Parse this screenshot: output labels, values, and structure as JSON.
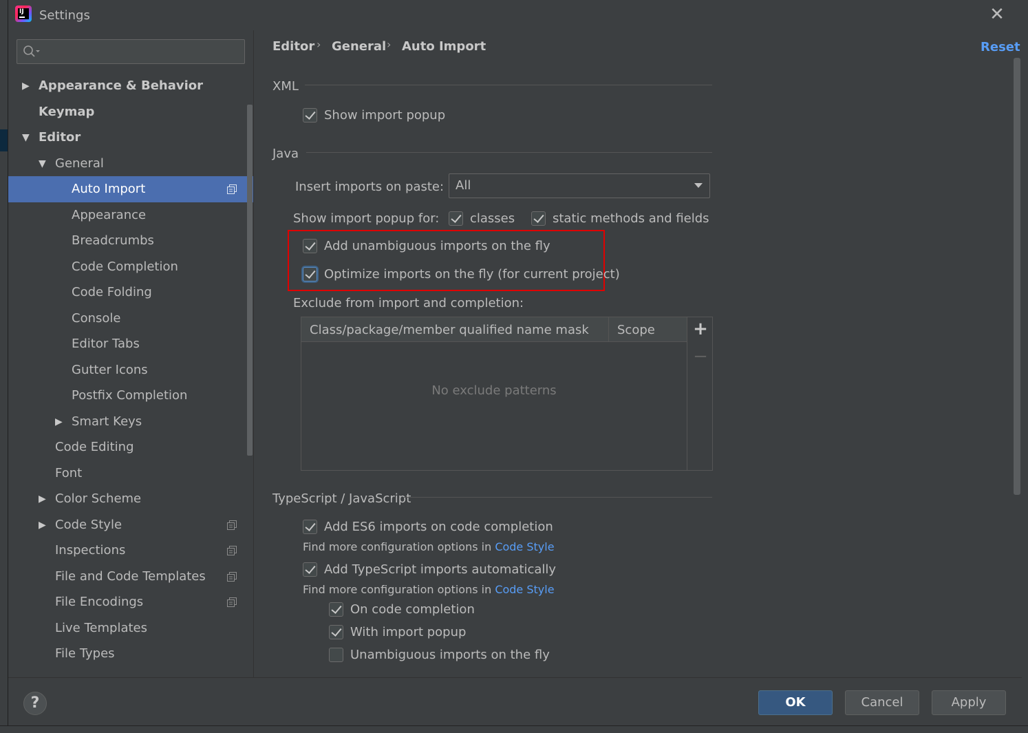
{
  "window": {
    "title": "Settings"
  },
  "search": {
    "placeholder": "",
    "value": ""
  },
  "tree": {
    "items": [
      {
        "label": "Appearance & Behavior",
        "depth": 0,
        "bold": true,
        "expandable": true,
        "expanded": false
      },
      {
        "label": "Keymap",
        "depth": 0,
        "bold": true,
        "expandable": false
      },
      {
        "label": "Editor",
        "depth": 0,
        "bold": true,
        "expandable": true,
        "expanded": true
      },
      {
        "label": "General",
        "depth": 1,
        "expandable": true,
        "expanded": true
      },
      {
        "label": "Auto Import",
        "depth": 2,
        "selected": true,
        "project_icon": true
      },
      {
        "label": "Appearance",
        "depth": 2
      },
      {
        "label": "Breadcrumbs",
        "depth": 2
      },
      {
        "label": "Code Completion",
        "depth": 2
      },
      {
        "label": "Code Folding",
        "depth": 2
      },
      {
        "label": "Console",
        "depth": 2
      },
      {
        "label": "Editor Tabs",
        "depth": 2
      },
      {
        "label": "Gutter Icons",
        "depth": 2
      },
      {
        "label": "Postfix Completion",
        "depth": 2
      },
      {
        "label": "Smart Keys",
        "depth": 2,
        "expandable": true,
        "expanded": false
      },
      {
        "label": "Code Editing",
        "depth": 1
      },
      {
        "label": "Font",
        "depth": 1
      },
      {
        "label": "Color Scheme",
        "depth": 1,
        "expandable": true,
        "expanded": false
      },
      {
        "label": "Code Style",
        "depth": 1,
        "expandable": true,
        "expanded": false,
        "project_icon": true
      },
      {
        "label": "Inspections",
        "depth": 1,
        "project_icon": true
      },
      {
        "label": "File and Code Templates",
        "depth": 1,
        "project_icon": true
      },
      {
        "label": "File Encodings",
        "depth": 1,
        "project_icon": true
      },
      {
        "label": "Live Templates",
        "depth": 1
      },
      {
        "label": "File Types",
        "depth": 1
      }
    ]
  },
  "breadcrumb": {
    "items": [
      "Editor",
      "General",
      "Auto Import"
    ],
    "separator": "›"
  },
  "reset_label": "Reset",
  "xml": {
    "title": "XML",
    "show_import_popup": {
      "label": "Show import popup",
      "checked": true
    }
  },
  "java": {
    "title": "Java",
    "insert_imports_label": "Insert imports on paste:",
    "insert_imports_value": "All",
    "show_popup_label": "Show import popup for:",
    "classes": {
      "label": "classes",
      "checked": true
    },
    "static_methods": {
      "label": "static methods and fields",
      "checked": true
    },
    "add_unambiguous": {
      "label": "Add unambiguous imports on the fly",
      "checked": true
    },
    "optimize_imports": {
      "label": "Optimize imports on the fly (for current project)",
      "checked": true
    },
    "exclude_label": "Exclude from import and completion:",
    "table": {
      "columns": [
        "Class/package/member qualified name mask",
        "Scope"
      ],
      "empty_text": "No exclude patterns",
      "rows": []
    }
  },
  "typescript": {
    "title": "TypeScript / JavaScript",
    "add_es6": {
      "label": "Add ES6 imports on code completion",
      "checked": true
    },
    "hint_prefix": "Find more configuration options in",
    "hint_link": "Code Style",
    "add_ts_auto": {
      "label": "Add TypeScript imports automatically",
      "checked": true
    },
    "on_code_completion": {
      "label": "On code completion",
      "checked": true
    },
    "with_import_popup": {
      "label": "With import popup",
      "checked": true
    },
    "unambiguous_fly": {
      "label": "Unambiguous imports on the fly",
      "checked": false
    }
  },
  "buttons": {
    "ok": "OK",
    "cancel": "Cancel",
    "apply": "Apply",
    "help": "?"
  },
  "colors": {
    "accent": "#4b6eaf",
    "link": "#589df6",
    "highlight": "#e00000",
    "primary_button": "#365880"
  }
}
